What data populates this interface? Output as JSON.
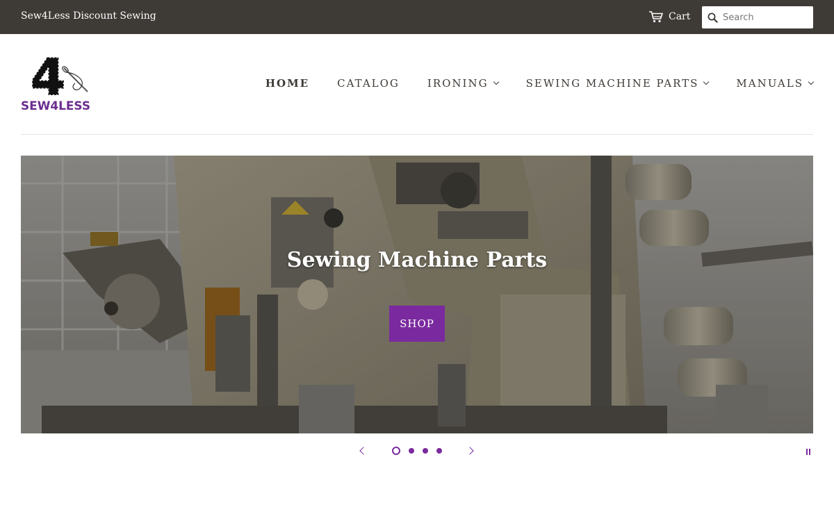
{
  "topbar": {
    "store_name": "Sew4Less Discount Sewing",
    "cart_label": "Cart",
    "search_placeholder": "Search"
  },
  "logo": {
    "numeral": "4",
    "wordmark": "SEW4LESS"
  },
  "nav": {
    "items": [
      {
        "label": "Home",
        "active": true,
        "dropdown": false
      },
      {
        "label": "Catalog",
        "active": false,
        "dropdown": false
      },
      {
        "label": "Ironing",
        "active": false,
        "dropdown": true
      },
      {
        "label": "Sewing Machine Parts",
        "active": false,
        "dropdown": true
      },
      {
        "label": "Manuals",
        "active": false,
        "dropdown": true
      }
    ]
  },
  "hero": {
    "title": "Sewing Machine Parts",
    "button_label": "Shop"
  },
  "slider": {
    "slide_count": 4,
    "current_slide": 1
  },
  "colors": {
    "topbar_bg": "#3e3a36",
    "accent": "#7a2a9e",
    "nav_text": "#3e3a36"
  },
  "icons": {
    "cart": "cart-icon",
    "search": "search-icon",
    "prev": "chevron-left-icon",
    "next": "chevron-right-icon",
    "pause": "pause-icon"
  }
}
